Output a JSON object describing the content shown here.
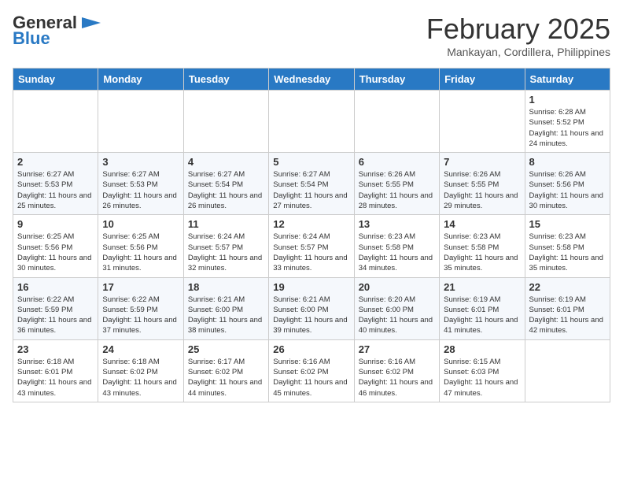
{
  "header": {
    "logo_general": "General",
    "logo_blue": "Blue",
    "month": "February 2025",
    "location": "Mankayan, Cordillera, Philippines"
  },
  "weekdays": [
    "Sunday",
    "Monday",
    "Tuesday",
    "Wednesday",
    "Thursday",
    "Friday",
    "Saturday"
  ],
  "weeks": [
    [
      {
        "day": "",
        "info": ""
      },
      {
        "day": "",
        "info": ""
      },
      {
        "day": "",
        "info": ""
      },
      {
        "day": "",
        "info": ""
      },
      {
        "day": "",
        "info": ""
      },
      {
        "day": "",
        "info": ""
      },
      {
        "day": "1",
        "info": "Sunrise: 6:28 AM\nSunset: 5:52 PM\nDaylight: 11 hours and 24 minutes."
      }
    ],
    [
      {
        "day": "2",
        "info": "Sunrise: 6:27 AM\nSunset: 5:53 PM\nDaylight: 11 hours and 25 minutes."
      },
      {
        "day": "3",
        "info": "Sunrise: 6:27 AM\nSunset: 5:53 PM\nDaylight: 11 hours and 26 minutes."
      },
      {
        "day": "4",
        "info": "Sunrise: 6:27 AM\nSunset: 5:54 PM\nDaylight: 11 hours and 26 minutes."
      },
      {
        "day": "5",
        "info": "Sunrise: 6:27 AM\nSunset: 5:54 PM\nDaylight: 11 hours and 27 minutes."
      },
      {
        "day": "6",
        "info": "Sunrise: 6:26 AM\nSunset: 5:55 PM\nDaylight: 11 hours and 28 minutes."
      },
      {
        "day": "7",
        "info": "Sunrise: 6:26 AM\nSunset: 5:55 PM\nDaylight: 11 hours and 29 minutes."
      },
      {
        "day": "8",
        "info": "Sunrise: 6:26 AM\nSunset: 5:56 PM\nDaylight: 11 hours and 30 minutes."
      }
    ],
    [
      {
        "day": "9",
        "info": "Sunrise: 6:25 AM\nSunset: 5:56 PM\nDaylight: 11 hours and 30 minutes."
      },
      {
        "day": "10",
        "info": "Sunrise: 6:25 AM\nSunset: 5:56 PM\nDaylight: 11 hours and 31 minutes."
      },
      {
        "day": "11",
        "info": "Sunrise: 6:24 AM\nSunset: 5:57 PM\nDaylight: 11 hours and 32 minutes."
      },
      {
        "day": "12",
        "info": "Sunrise: 6:24 AM\nSunset: 5:57 PM\nDaylight: 11 hours and 33 minutes."
      },
      {
        "day": "13",
        "info": "Sunrise: 6:23 AM\nSunset: 5:58 PM\nDaylight: 11 hours and 34 minutes."
      },
      {
        "day": "14",
        "info": "Sunrise: 6:23 AM\nSunset: 5:58 PM\nDaylight: 11 hours and 35 minutes."
      },
      {
        "day": "15",
        "info": "Sunrise: 6:23 AM\nSunset: 5:58 PM\nDaylight: 11 hours and 35 minutes."
      }
    ],
    [
      {
        "day": "16",
        "info": "Sunrise: 6:22 AM\nSunset: 5:59 PM\nDaylight: 11 hours and 36 minutes."
      },
      {
        "day": "17",
        "info": "Sunrise: 6:22 AM\nSunset: 5:59 PM\nDaylight: 11 hours and 37 minutes."
      },
      {
        "day": "18",
        "info": "Sunrise: 6:21 AM\nSunset: 6:00 PM\nDaylight: 11 hours and 38 minutes."
      },
      {
        "day": "19",
        "info": "Sunrise: 6:21 AM\nSunset: 6:00 PM\nDaylight: 11 hours and 39 minutes."
      },
      {
        "day": "20",
        "info": "Sunrise: 6:20 AM\nSunset: 6:00 PM\nDaylight: 11 hours and 40 minutes."
      },
      {
        "day": "21",
        "info": "Sunrise: 6:19 AM\nSunset: 6:01 PM\nDaylight: 11 hours and 41 minutes."
      },
      {
        "day": "22",
        "info": "Sunrise: 6:19 AM\nSunset: 6:01 PM\nDaylight: 11 hours and 42 minutes."
      }
    ],
    [
      {
        "day": "23",
        "info": "Sunrise: 6:18 AM\nSunset: 6:01 PM\nDaylight: 11 hours and 43 minutes."
      },
      {
        "day": "24",
        "info": "Sunrise: 6:18 AM\nSunset: 6:02 PM\nDaylight: 11 hours and 43 minutes."
      },
      {
        "day": "25",
        "info": "Sunrise: 6:17 AM\nSunset: 6:02 PM\nDaylight: 11 hours and 44 minutes."
      },
      {
        "day": "26",
        "info": "Sunrise: 6:16 AM\nSunset: 6:02 PM\nDaylight: 11 hours and 45 minutes."
      },
      {
        "day": "27",
        "info": "Sunrise: 6:16 AM\nSunset: 6:02 PM\nDaylight: 11 hours and 46 minutes."
      },
      {
        "day": "28",
        "info": "Sunrise: 6:15 AM\nSunset: 6:03 PM\nDaylight: 11 hours and 47 minutes."
      },
      {
        "day": "",
        "info": ""
      }
    ]
  ]
}
